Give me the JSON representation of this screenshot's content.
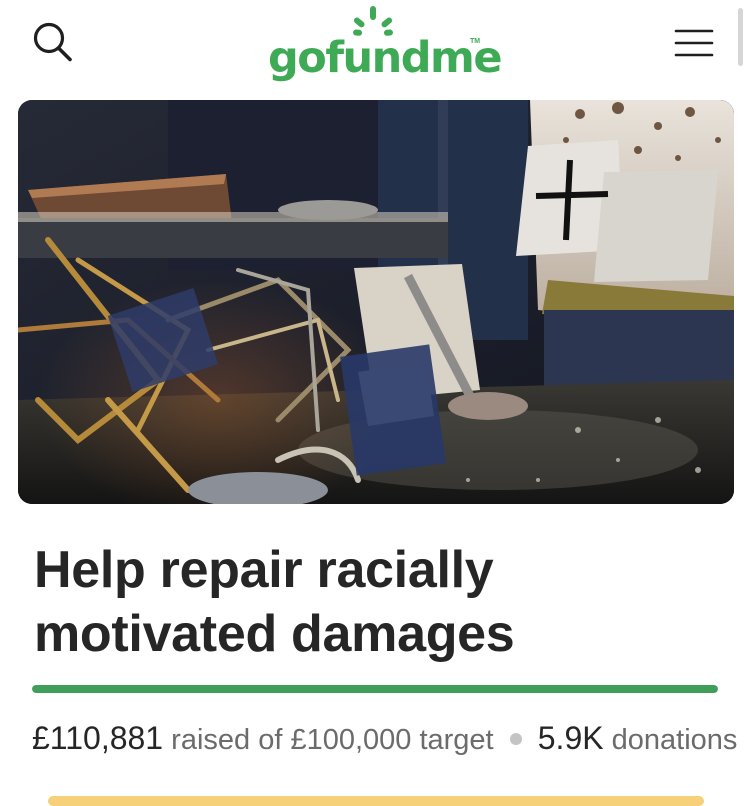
{
  "header": {
    "logo_text": "gofundme",
    "logo_tm": "TM",
    "search_icon": "search-icon",
    "menu_icon": "hamburger-menu-icon",
    "brand_color": "#3faa55"
  },
  "hero": {
    "image": "fire-damaged-room-photo"
  },
  "campaign": {
    "title": "Help repair racially motivated damages",
    "raised_amount": "£110,881",
    "raised_of": "raised of £100,000 target",
    "donations_count": "5.9K",
    "donations_label": "donations",
    "progress_fraction": 1.0,
    "progress_color": "#3f9e5a"
  }
}
